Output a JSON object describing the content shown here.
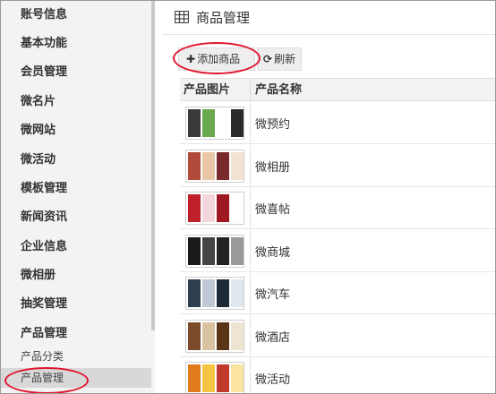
{
  "sidebar": {
    "items": [
      {
        "label": "账号信息"
      },
      {
        "label": "基本功能"
      },
      {
        "label": "会员管理"
      },
      {
        "label": "微名片"
      },
      {
        "label": "微网站"
      },
      {
        "label": "微活动"
      },
      {
        "label": "模板管理"
      },
      {
        "label": "新闻资讯"
      },
      {
        "label": "企业信息"
      },
      {
        "label": "微相册"
      },
      {
        "label": "抽奖管理"
      },
      {
        "label": "产品管理"
      }
    ],
    "sub_items": [
      {
        "label": "产品分类",
        "active": false
      },
      {
        "label": "产品管理",
        "active": true
      }
    ]
  },
  "header": {
    "icon": "table-grid-icon",
    "title": "商品管理"
  },
  "toolbar": {
    "add_icon": "plus-icon",
    "add_label": "添加商品",
    "refresh_icon": "refresh-icon",
    "refresh_label": "刷新"
  },
  "table": {
    "columns": [
      "产品图片",
      "产品名称"
    ],
    "rows": [
      {
        "name": "微预约",
        "thumb_colors": [
          "#3a3a3a",
          "#6aa84f",
          "#ffffff",
          "#2b2b2b"
        ]
      },
      {
        "name": "微相册",
        "thumb_colors": [
          "#b04a3a",
          "#e8c6a6",
          "#7a2a2a",
          "#f4e2d0"
        ]
      },
      {
        "name": "微喜帖",
        "thumb_colors": [
          "#c0202a",
          "#f2d6dc",
          "#a01822",
          "#ffffff"
        ]
      },
      {
        "name": "微商城",
        "thumb_colors": [
          "#1a1a1a",
          "#444444",
          "#222222",
          "#999999"
        ]
      },
      {
        "name": "微汽车",
        "thumb_colors": [
          "#2c3e50",
          "#bfc9d4",
          "#1d2b38",
          "#dfe6ec"
        ]
      },
      {
        "name": "微酒店",
        "thumb_colors": [
          "#7a4a2a",
          "#d9c2a0",
          "#5a3518",
          "#efe4d2"
        ]
      },
      {
        "name": "微活动",
        "thumb_colors": [
          "#e07a1a",
          "#f5c542",
          "#c0392b",
          "#fbe3a0"
        ]
      }
    ]
  },
  "annotation_color": "#e0162b"
}
